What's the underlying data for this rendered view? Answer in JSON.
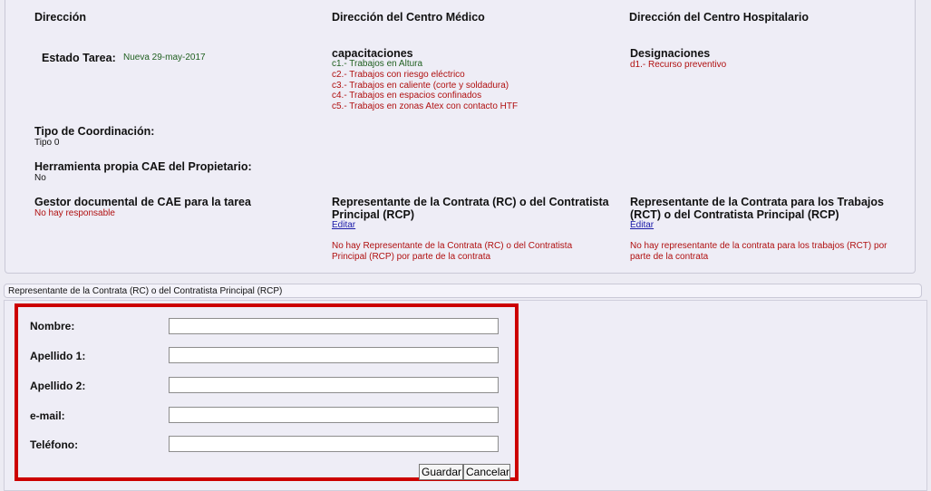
{
  "columns": {
    "col1": "Dirección",
    "col2": "Dirección del Centro Médico",
    "col3": "Dirección del Centro Hospitalario"
  },
  "estado": {
    "label": "Estado Tarea:",
    "value": "Nueva 29-may-2017"
  },
  "capacitaciones": {
    "title": "capacitaciones",
    "items": [
      "c1.- Trabajos en Altura",
      "c2.- Trabajos con riesgo eléctrico",
      "c3.- Trabajos en caliente (corte y soldadura)",
      "c4.- Trabajos en espacios confinados",
      "c5.- Trabajos en zonas Atex con contacto HTF"
    ]
  },
  "designaciones": {
    "title": "Designaciones",
    "items": [
      "d1.- Recurso preventivo"
    ]
  },
  "tipo": {
    "label": "Tipo de Coordinación:",
    "value": "Tipo 0"
  },
  "herramienta": {
    "label": "Herramienta propia CAE del Propietario:",
    "value": "No"
  },
  "gestor": {
    "label": "Gestor documental de CAE para la tarea",
    "value": "No hay responsable"
  },
  "rc": {
    "label_line1": "Representante de la Contrata (RC) o del Contratista",
    "label_line2": "Principal (RCP)",
    "edit": "Editar",
    "msg_line1": "No hay Representante de la Contrata (RC) o del Contratista",
    "msg_line2": "Principal (RCP) por parte de la contrata"
  },
  "rct": {
    "label_line1": "Representante de la Contrata para los Trabajos",
    "label_line2": "(RCT) o del Contratista Principal (RCP)",
    "edit": "Editar",
    "msg_line1": "No hay representante de la contrata para los trabajos (RCT) por",
    "msg_line2": "parte de la contrata"
  },
  "form": {
    "section_title": "Representante de la Contrata (RC) o del Contratista Principal (RCP)",
    "fields": {
      "nombre": {
        "label": "Nombre:",
        "value": ""
      },
      "apellido1": {
        "label": "Apellido 1:",
        "value": ""
      },
      "apellido2": {
        "label": "Apellido 2:",
        "value": ""
      },
      "email": {
        "label": "e-mail:",
        "value": ""
      },
      "telefono": {
        "label": "Teléfono:",
        "value": ""
      }
    },
    "save_label": "Guardar",
    "cancel_label": "Cancelar"
  },
  "colors": {
    "highlight_border": "#cc0000",
    "status_green": "#1f5f1f",
    "message_red": "#b01010",
    "link_blue": "#1a1aa8"
  }
}
